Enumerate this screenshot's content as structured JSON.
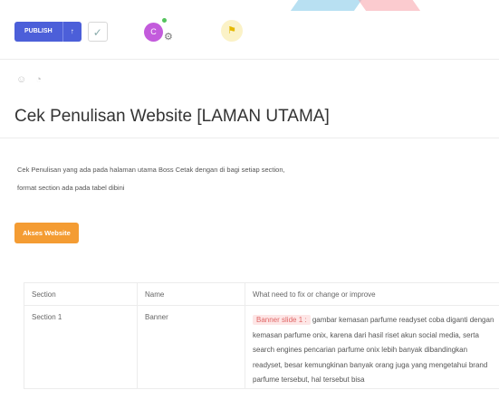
{
  "toolbar": {
    "publish_label": "PUBLISH",
    "publish_caret": "↑",
    "check_icon": "check-icon",
    "avatar_initial": "C",
    "flag_icon": "flag-icon"
  },
  "page": {
    "title": "Cek Penulisan Website [LAMAN UTAMA]",
    "description_line1": "Cek Penulisan yang ada pada halaman utama Boss Cetak dengan di bagi setiap section,",
    "description_line2": "format section ada pada tabel dibini",
    "action_button": "Akses Website"
  },
  "table": {
    "headers": [
      "Section",
      "Name",
      "What need to fix or change or improve"
    ],
    "rows": [
      {
        "section": "Section 1",
        "name": "Banner",
        "tag": "Banner slide 1 :",
        "text": "gambar kemasan parfume readyset coba diganti dengan kemasan parfume onix, karena dari hasil riset akun social media, serta search engines pencarian parfume onix lebih banyak dibandingkan readyset, besar kemungkinan banyak orang juga yang mengetahui brand parfume tersebut, hal tersebut bisa"
      }
    ]
  },
  "colors": {
    "publish": "#4c5fd9",
    "action": "#f49c33",
    "avatar": "#c35bdc",
    "tag_bg": "#fde6e6",
    "tag_text": "#e06666"
  }
}
